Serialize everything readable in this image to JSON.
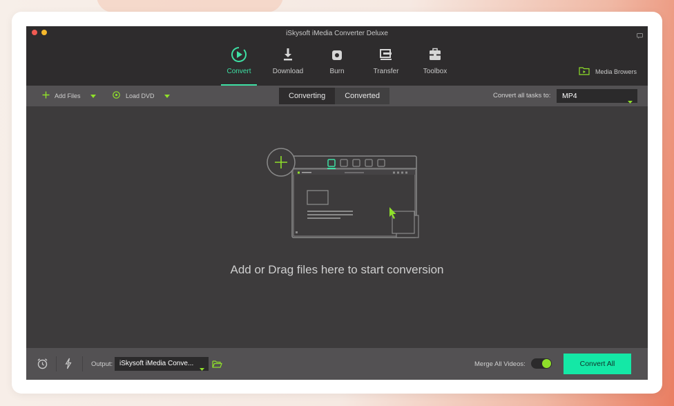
{
  "window": {
    "title": "iSkysoft iMedia Converter Deluxe"
  },
  "nav": {
    "items": [
      {
        "label": "Convert",
        "icon": "convert-icon",
        "active": true
      },
      {
        "label": "Download",
        "icon": "download-icon",
        "active": false
      },
      {
        "label": "Burn",
        "icon": "burn-icon",
        "active": false
      },
      {
        "label": "Transfer",
        "icon": "transfer-icon",
        "active": false
      },
      {
        "label": "Toolbox",
        "icon": "toolbox-icon",
        "active": false
      }
    ],
    "media_browser_label": "Media Browers"
  },
  "toolbar": {
    "add_files_label": "Add Files",
    "load_dvd_label": "Load DVD",
    "tabs": [
      {
        "label": "Converting",
        "active": true
      },
      {
        "label": "Converted",
        "active": false
      }
    ],
    "convert_all_label": "Convert all tasks to:",
    "format_value": "MP4"
  },
  "main": {
    "drop_hint": "Add or Drag files here to start conversion"
  },
  "bottom": {
    "output_label": "Output:",
    "output_value": "iSkysoft iMedia Conve...",
    "merge_label": "Merge All Videos:",
    "merge_enabled": true,
    "convert_all_button": "Convert All"
  },
  "colors": {
    "accent": "#3ee0a4",
    "convert_button": "#14e8a6",
    "toggle_on": "#8fe02a",
    "plus_green": "#7ed321",
    "window_bg": "#3d3b3c",
    "bar_bg": "#535153"
  }
}
